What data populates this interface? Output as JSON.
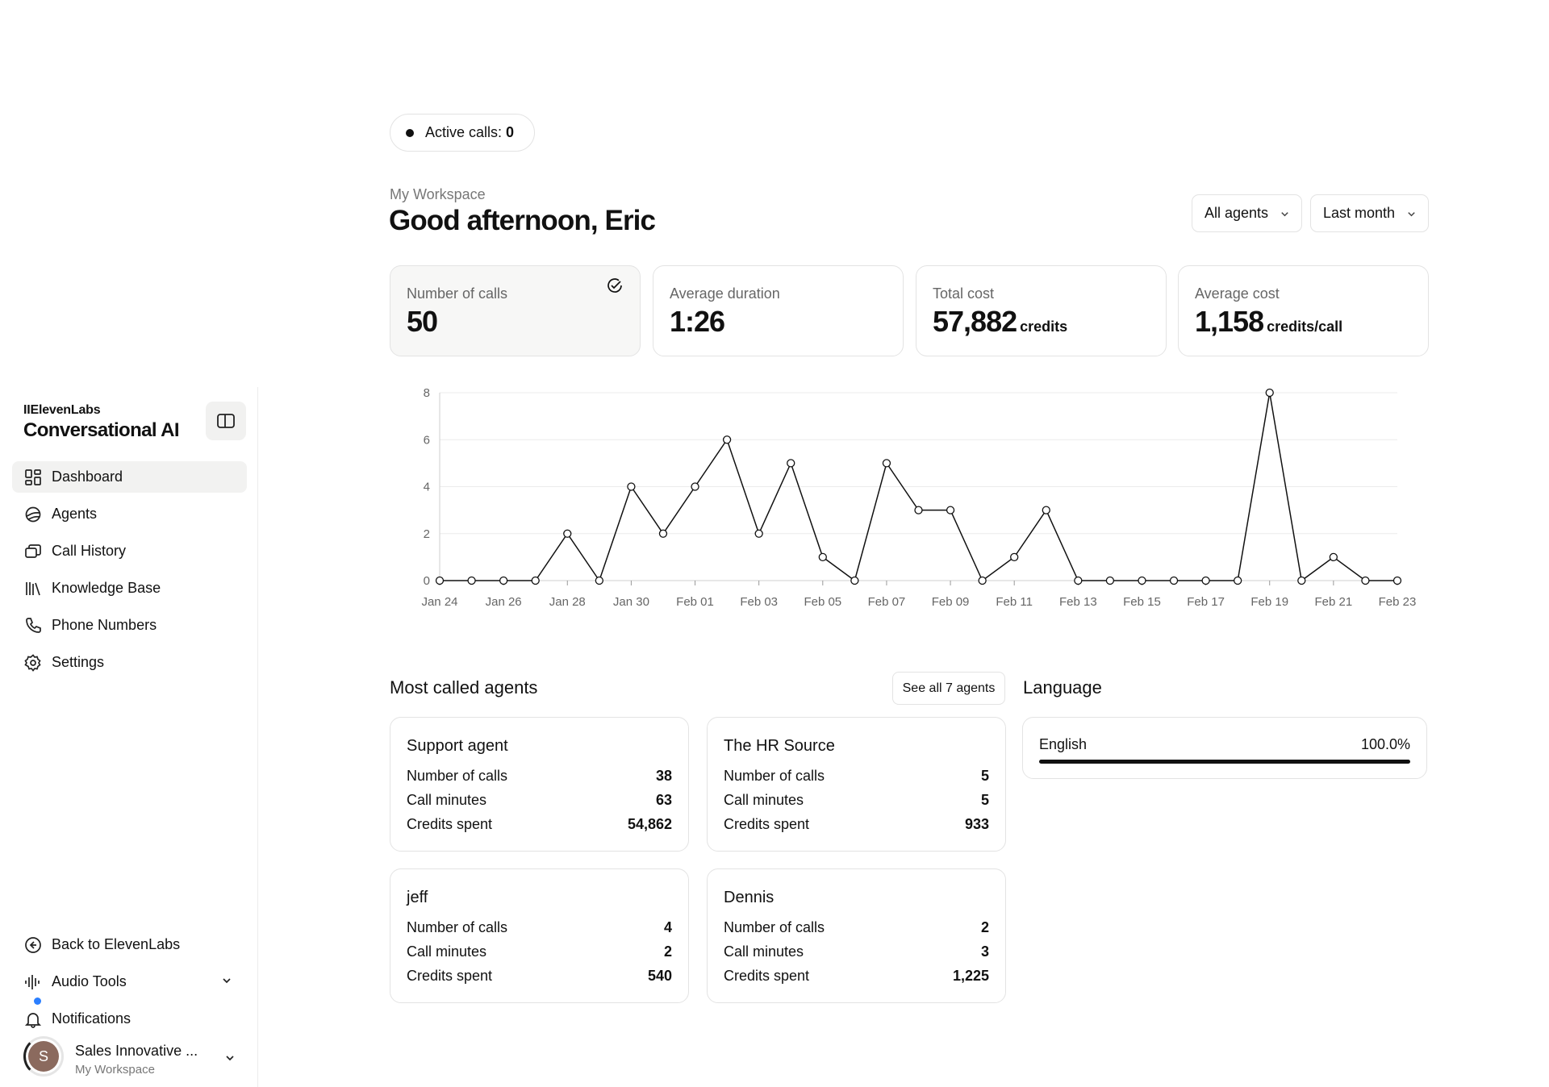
{
  "sidebar": {
    "brand_small": "IIElevenLabs",
    "brand_big": "Conversational AI",
    "nav": [
      {
        "label": "Dashboard",
        "icon": "dashboard-icon",
        "active": true
      },
      {
        "label": "Agents",
        "icon": "agents-icon"
      },
      {
        "label": "Call History",
        "icon": "call-history-icon"
      },
      {
        "label": "Knowledge Base",
        "icon": "knowledge-base-icon"
      },
      {
        "label": "Phone Numbers",
        "icon": "phone-icon"
      },
      {
        "label": "Settings",
        "icon": "gear-icon"
      }
    ],
    "bottom": [
      {
        "label": "Back to ElevenLabs",
        "icon": "back-arrow-icon"
      },
      {
        "label": "Audio Tools",
        "icon": "waveform-icon"
      },
      {
        "label": "Notifications",
        "icon": "bell-icon"
      }
    ],
    "user": {
      "initial": "S",
      "name": "Sales Innovative ...",
      "workspace": "My Workspace"
    }
  },
  "header": {
    "active_calls_label": "Active calls: ",
    "active_calls_value": "0",
    "workspace": "My Workspace",
    "greeting": "Good afternoon, Eric",
    "agent_filter": "All agents",
    "period_filter": "Last month"
  },
  "stats": [
    {
      "label": "Number of calls",
      "value": "50",
      "unit": ""
    },
    {
      "label": "Average duration",
      "value": "1:26",
      "unit": ""
    },
    {
      "label": "Total cost",
      "value": "57,882",
      "unit": "credits"
    },
    {
      "label": "Average cost",
      "value": "1,158",
      "unit": "credits/call"
    }
  ],
  "chart_data": {
    "type": "line",
    "x": [
      "Jan 24",
      "Jan 25",
      "Jan 26",
      "Jan 27",
      "Jan 28",
      "Jan 29",
      "Jan 30",
      "Jan 31",
      "Feb 01",
      "Feb 02",
      "Feb 03",
      "Feb 04",
      "Feb 05",
      "Feb 06",
      "Feb 07",
      "Feb 08",
      "Feb 09",
      "Feb 10",
      "Feb 11",
      "Feb 12",
      "Feb 13",
      "Feb 14",
      "Feb 15",
      "Feb 16",
      "Feb 17",
      "Feb 18",
      "Feb 19",
      "Feb 20",
      "Feb 21",
      "Feb 22",
      "Feb 23"
    ],
    "values": [
      0,
      0,
      0,
      0,
      2,
      0,
      4,
      2,
      4,
      6,
      2,
      5,
      1,
      0,
      5,
      3,
      3,
      0,
      1,
      3,
      0,
      0,
      0,
      0,
      0,
      0,
      8,
      0,
      1,
      0,
      0
    ],
    "x_tick_labels": [
      "Jan 24",
      "Jan 26",
      "Jan 28",
      "Jan 30",
      "Feb 01",
      "Feb 03",
      "Feb 05",
      "Feb 07",
      "Feb 09",
      "Feb 11",
      "Feb 13",
      "Feb 15",
      "Feb 17",
      "Feb 19",
      "Feb 21",
      "Feb 23"
    ],
    "y_ticks": [
      0,
      2,
      4,
      6,
      8
    ],
    "ylim": [
      0,
      8
    ],
    "grid": true,
    "color": "#111111"
  },
  "agents_section": {
    "title": "Most called agents",
    "see_all": "See all 7 agents",
    "row_labels": [
      "Number of calls",
      "Call minutes",
      "Credits spent"
    ],
    "agents": [
      {
        "name": "Support agent",
        "calls": "38",
        "minutes": "63",
        "credits": "54,862"
      },
      {
        "name": "The HR Source",
        "calls": "5",
        "minutes": "5",
        "credits": "933"
      },
      {
        "name": "jeff",
        "calls": "4",
        "minutes": "2",
        "credits": "540"
      },
      {
        "name": "Dennis",
        "calls": "2",
        "minutes": "3",
        "credits": "1,225"
      }
    ]
  },
  "language_section": {
    "title": "Language",
    "items": [
      {
        "name": "English",
        "percent_label": "100.0%",
        "fraction": 1.0
      }
    ]
  }
}
